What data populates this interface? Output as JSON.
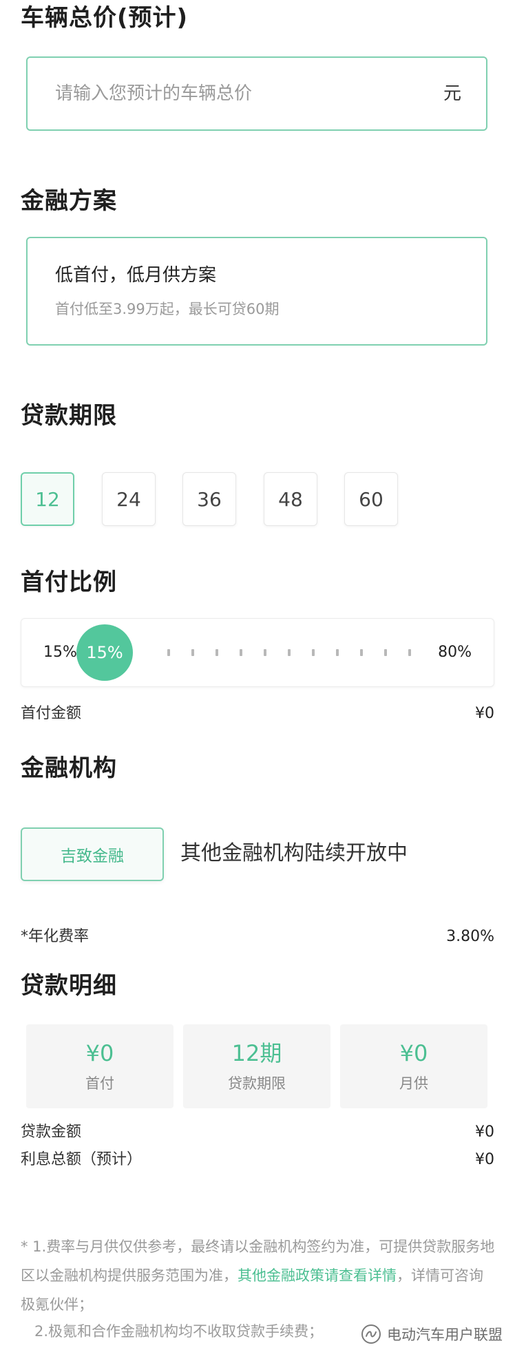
{
  "vehicle_price": {
    "title": "车辆总价(预计)",
    "placeholder": "请输入您预计的车辆总价",
    "unit": "元"
  },
  "finance_plan": {
    "title": "金融方案",
    "option_title": "低首付，低月供方案",
    "option_subtitle": "首付低至3.99万起，最长可贷60期"
  },
  "loan_term": {
    "title": "贷款期限",
    "options": [
      "12",
      "24",
      "36",
      "48",
      "60"
    ],
    "selected": "12"
  },
  "down_payment": {
    "title": "首付比例",
    "min_label": "15%",
    "max_label": "80%",
    "current_label": "15%",
    "current_value": 0.15,
    "amount_label": "首付金额",
    "amount_value": "¥0"
  },
  "institution": {
    "title": "金融机构",
    "selected_name": "吉致金融",
    "note": "其他金融机构陆续开放中",
    "rate_label": "*年化费率",
    "rate_value": "3.80%"
  },
  "loan_detail": {
    "title": "贷款明细",
    "cards": [
      {
        "value": "¥0",
        "label": "首付"
      },
      {
        "value": "12期",
        "label": "贷款期限"
      },
      {
        "value": "¥0",
        "label": "月供"
      }
    ],
    "loan_amount_label": "贷款金额",
    "loan_amount_value": "¥0",
    "interest_label": "利息总额（预计）",
    "interest_value": "¥0"
  },
  "disclaimer": {
    "line1_text": "* 1.费率与月供仅供参考，最终请以金融机构签约为准，可提供贷款服务地区以金融机构提供服务范围为准，",
    "link_text": "其他金融政策请查看详情",
    "line1_tail": "，详情可咨询极氪伙伴；",
    "line2": "2.极氪和合作金融机构均不收取贷款手续费；"
  },
  "watermark": {
    "text": "电动汽车用户联盟",
    "icon": "wechat-channel-icon"
  },
  "colors": {
    "accent": "#4cbf92",
    "accent_border": "#7fd0b0",
    "muted_text": "#9a9a9a"
  }
}
